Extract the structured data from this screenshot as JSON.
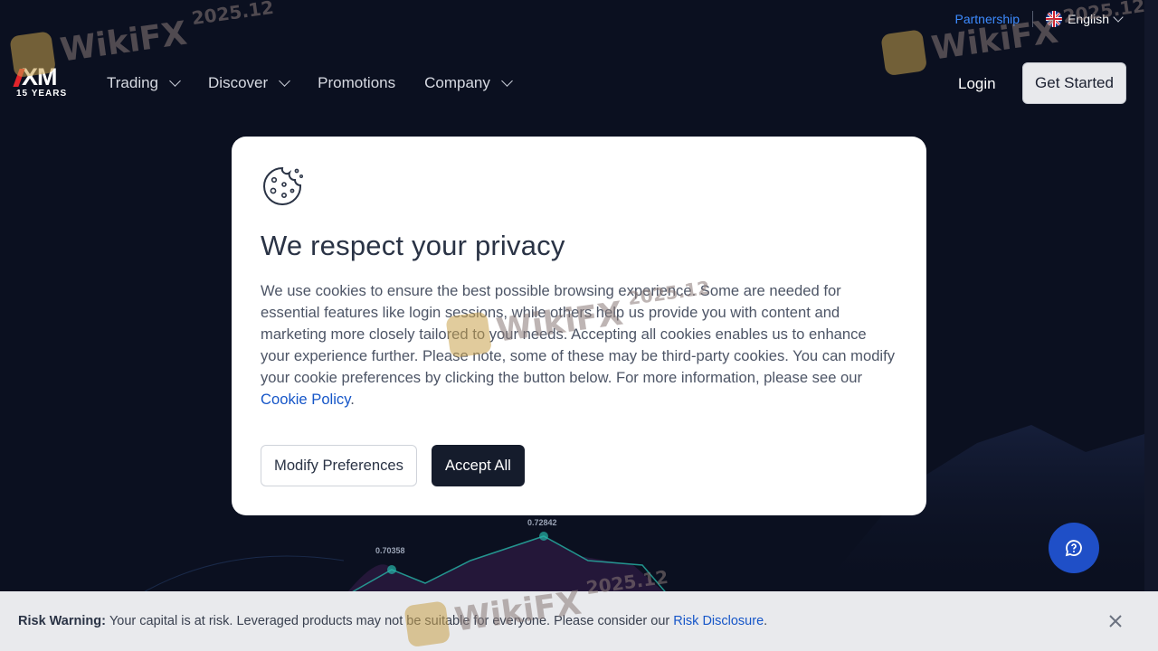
{
  "header": {
    "partnership_label": "Partnership",
    "language_label": "English",
    "logo": {
      "brand": "XM",
      "tagline": "15 YEARS"
    },
    "nav": [
      {
        "label": "Trading",
        "has_dropdown": true
      },
      {
        "label": "Discover",
        "has_dropdown": true
      },
      {
        "label": "Promotions",
        "has_dropdown": false
      },
      {
        "label": "Company",
        "has_dropdown": true
      }
    ],
    "login_label": "Login",
    "get_started_label": "Get Started"
  },
  "modal": {
    "icon": "cookie-icon",
    "title": "We respect your privacy",
    "body": "We use cookies to ensure the best possible browsing experience. Some are needed for essential features like login sessions, while others help us provide you with content and marketing more closely tailored to your needs. Accepting all cookies enables us to enhance your experience further. Please note, some of these may be third-party cookies. You can modify your cookie preferences by clicking the button below. For more information, please see our",
    "policy_link": "Cookie Policy",
    "body_end": ".",
    "modify_label": "Modify Preferences",
    "accept_label": "Accept All"
  },
  "background_chart": {
    "point_labels": [
      "0.70358",
      "0.72842"
    ]
  },
  "chat": {
    "icon": "chat-help-icon"
  },
  "risk_bar": {
    "heading": "Risk Warning:",
    "text": "Your capital is at risk. Leveraged products may not be suitable for everyone. Please consider our",
    "link": "Risk Disclosure",
    "end": "."
  },
  "watermark": {
    "text": "WikiFX",
    "year": "2025.12"
  },
  "colors": {
    "background": "#0b1020",
    "accent_link": "#1656c8",
    "partnership": "#3d8bff",
    "chat_button": "#1f4fc7",
    "accept_button": "#151c2c"
  }
}
